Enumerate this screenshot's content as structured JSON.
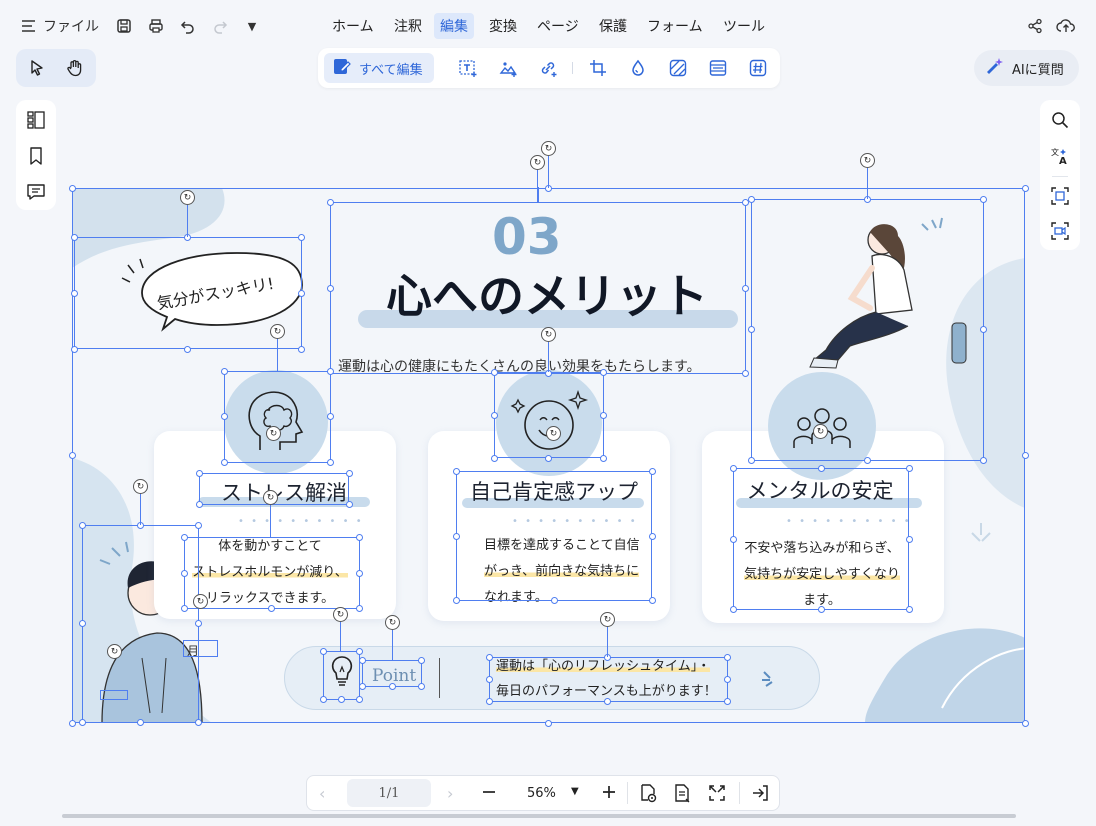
{
  "menubar": {
    "file_label": "ファイル",
    "tabs": [
      "ホーム",
      "注釈",
      "編集",
      "変換",
      "ページ",
      "保護",
      "フォーム",
      "ツール"
    ],
    "active_tab": "編集"
  },
  "toolbar": {
    "edit_all_label": "すべて編集",
    "ai_label": "AIに質問"
  },
  "document": {
    "number": "03",
    "title": "心へのメリット",
    "subtitle": "運動は心の健康にもたくさんの良い効果をもたらします。",
    "bubble_text": "気分がスッキリ!",
    "cards": [
      {
        "title": "ストレス解消",
        "lines": [
          "体を動かすことて",
          "ストレスホルモンが減り、",
          "リラックスできます。"
        ]
      },
      {
        "title": "自己肯定感アップ",
        "lines": [
          "目標を達成することて自信",
          "がっき、前向きな気持ちに",
          "なれます。"
        ]
      },
      {
        "title": "メンタルの安定",
        "lines": [
          "不安や落ち込みが和らぎ、",
          "気持ちが安定しやすくなり",
          "ます。"
        ]
      }
    ],
    "point_label": "Point",
    "point_lines": [
      "運動は「心のリフレッシュタイム」・",
      "毎日のパフォーマンスも上がります！"
    ],
    "small_label": "月"
  },
  "bottombar": {
    "page_indicator": "1/1",
    "zoom": "56%"
  },
  "colors": {
    "accent": "#2f67d8",
    "selection": "#4f7ef0",
    "title_number": "#7ea6c9",
    "card_circle": "#c9dcec",
    "highlight": "#fbe6a6"
  }
}
